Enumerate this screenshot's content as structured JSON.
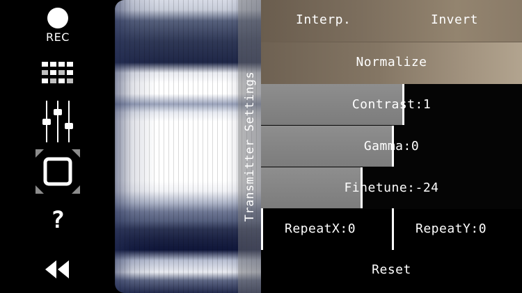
{
  "toolbar": {
    "rec_label": "REC",
    "icons": [
      "record-icon",
      "grid-icon",
      "mixer-sliders-icon",
      "fullscreen-icon",
      "help-icon",
      "rewind-icon"
    ],
    "help_glyph": "?"
  },
  "panel": {
    "title": "Transmitter Settings",
    "interp_label": "Interp.",
    "invert_label": "Invert",
    "normalize_label": "Normalize",
    "contrast_label": "Contrast:1",
    "gamma_label": "Gamma:0",
    "finetune_label": "Finetune:-24",
    "repeatx_label": "RepeatX:0",
    "repeaty_label": "RepeatY:0",
    "reset_label": "Reset"
  },
  "sliders": {
    "contrast_fill": 0.54,
    "gamma_fill": 0.5,
    "finetune_fill": 0.38
  },
  "colors": {
    "panel_brown": "#7d6f5e",
    "slider_gray": "#858585",
    "accent": "#ffffff"
  }
}
